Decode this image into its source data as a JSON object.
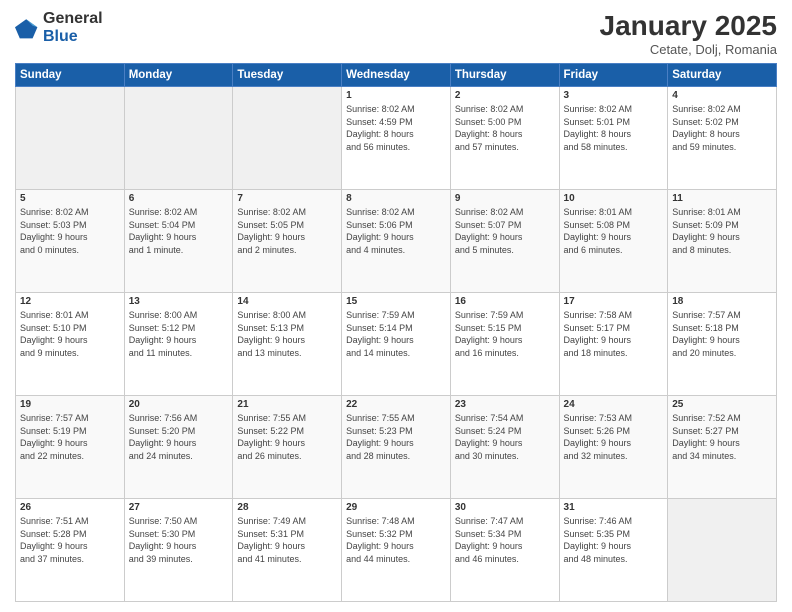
{
  "header": {
    "logo_general": "General",
    "logo_blue": "Blue",
    "month_title": "January 2025",
    "location": "Cetate, Dolj, Romania"
  },
  "days_of_week": [
    "Sunday",
    "Monday",
    "Tuesday",
    "Wednesday",
    "Thursday",
    "Friday",
    "Saturday"
  ],
  "weeks": [
    [
      {
        "day": "",
        "info": ""
      },
      {
        "day": "",
        "info": ""
      },
      {
        "day": "",
        "info": ""
      },
      {
        "day": "1",
        "info": "Sunrise: 8:02 AM\nSunset: 4:59 PM\nDaylight: 8 hours\nand 56 minutes."
      },
      {
        "day": "2",
        "info": "Sunrise: 8:02 AM\nSunset: 5:00 PM\nDaylight: 8 hours\nand 57 minutes."
      },
      {
        "day": "3",
        "info": "Sunrise: 8:02 AM\nSunset: 5:01 PM\nDaylight: 8 hours\nand 58 minutes."
      },
      {
        "day": "4",
        "info": "Sunrise: 8:02 AM\nSunset: 5:02 PM\nDaylight: 8 hours\nand 59 minutes."
      }
    ],
    [
      {
        "day": "5",
        "info": "Sunrise: 8:02 AM\nSunset: 5:03 PM\nDaylight: 9 hours\nand 0 minutes."
      },
      {
        "day": "6",
        "info": "Sunrise: 8:02 AM\nSunset: 5:04 PM\nDaylight: 9 hours\nand 1 minute."
      },
      {
        "day": "7",
        "info": "Sunrise: 8:02 AM\nSunset: 5:05 PM\nDaylight: 9 hours\nand 2 minutes."
      },
      {
        "day": "8",
        "info": "Sunrise: 8:02 AM\nSunset: 5:06 PM\nDaylight: 9 hours\nand 4 minutes."
      },
      {
        "day": "9",
        "info": "Sunrise: 8:02 AM\nSunset: 5:07 PM\nDaylight: 9 hours\nand 5 minutes."
      },
      {
        "day": "10",
        "info": "Sunrise: 8:01 AM\nSunset: 5:08 PM\nDaylight: 9 hours\nand 6 minutes."
      },
      {
        "day": "11",
        "info": "Sunrise: 8:01 AM\nSunset: 5:09 PM\nDaylight: 9 hours\nand 8 minutes."
      }
    ],
    [
      {
        "day": "12",
        "info": "Sunrise: 8:01 AM\nSunset: 5:10 PM\nDaylight: 9 hours\nand 9 minutes."
      },
      {
        "day": "13",
        "info": "Sunrise: 8:00 AM\nSunset: 5:12 PM\nDaylight: 9 hours\nand 11 minutes."
      },
      {
        "day": "14",
        "info": "Sunrise: 8:00 AM\nSunset: 5:13 PM\nDaylight: 9 hours\nand 13 minutes."
      },
      {
        "day": "15",
        "info": "Sunrise: 7:59 AM\nSunset: 5:14 PM\nDaylight: 9 hours\nand 14 minutes."
      },
      {
        "day": "16",
        "info": "Sunrise: 7:59 AM\nSunset: 5:15 PM\nDaylight: 9 hours\nand 16 minutes."
      },
      {
        "day": "17",
        "info": "Sunrise: 7:58 AM\nSunset: 5:17 PM\nDaylight: 9 hours\nand 18 minutes."
      },
      {
        "day": "18",
        "info": "Sunrise: 7:57 AM\nSunset: 5:18 PM\nDaylight: 9 hours\nand 20 minutes."
      }
    ],
    [
      {
        "day": "19",
        "info": "Sunrise: 7:57 AM\nSunset: 5:19 PM\nDaylight: 9 hours\nand 22 minutes."
      },
      {
        "day": "20",
        "info": "Sunrise: 7:56 AM\nSunset: 5:20 PM\nDaylight: 9 hours\nand 24 minutes."
      },
      {
        "day": "21",
        "info": "Sunrise: 7:55 AM\nSunset: 5:22 PM\nDaylight: 9 hours\nand 26 minutes."
      },
      {
        "day": "22",
        "info": "Sunrise: 7:55 AM\nSunset: 5:23 PM\nDaylight: 9 hours\nand 28 minutes."
      },
      {
        "day": "23",
        "info": "Sunrise: 7:54 AM\nSunset: 5:24 PM\nDaylight: 9 hours\nand 30 minutes."
      },
      {
        "day": "24",
        "info": "Sunrise: 7:53 AM\nSunset: 5:26 PM\nDaylight: 9 hours\nand 32 minutes."
      },
      {
        "day": "25",
        "info": "Sunrise: 7:52 AM\nSunset: 5:27 PM\nDaylight: 9 hours\nand 34 minutes."
      }
    ],
    [
      {
        "day": "26",
        "info": "Sunrise: 7:51 AM\nSunset: 5:28 PM\nDaylight: 9 hours\nand 37 minutes."
      },
      {
        "day": "27",
        "info": "Sunrise: 7:50 AM\nSunset: 5:30 PM\nDaylight: 9 hours\nand 39 minutes."
      },
      {
        "day": "28",
        "info": "Sunrise: 7:49 AM\nSunset: 5:31 PM\nDaylight: 9 hours\nand 41 minutes."
      },
      {
        "day": "29",
        "info": "Sunrise: 7:48 AM\nSunset: 5:32 PM\nDaylight: 9 hours\nand 44 minutes."
      },
      {
        "day": "30",
        "info": "Sunrise: 7:47 AM\nSunset: 5:34 PM\nDaylight: 9 hours\nand 46 minutes."
      },
      {
        "day": "31",
        "info": "Sunrise: 7:46 AM\nSunset: 5:35 PM\nDaylight: 9 hours\nand 48 minutes."
      },
      {
        "day": "",
        "info": ""
      }
    ]
  ]
}
